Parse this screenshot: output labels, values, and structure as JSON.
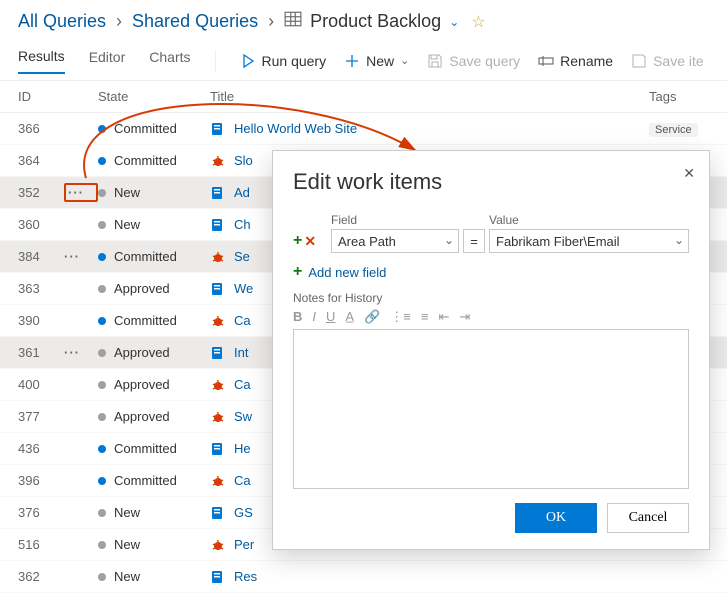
{
  "breadcrumb": {
    "root": "All Queries",
    "mid": "Shared Queries",
    "current": "Product Backlog"
  },
  "tabs": {
    "results": "Results",
    "editor": "Editor",
    "charts": "Charts"
  },
  "toolbar": {
    "run": "Run query",
    "new": "New",
    "save": "Save query",
    "rename": "Rename",
    "saveitems": "Save ite"
  },
  "columns": {
    "id": "ID",
    "state": "State",
    "title": "Title",
    "tags": "Tags"
  },
  "rows": [
    {
      "id": "366",
      "dots": false,
      "sel": false,
      "stateColor": "c-blue",
      "state": "Committed",
      "icon": "book",
      "title": "Hello World Web Site",
      "tag": "Service"
    },
    {
      "id": "364",
      "dots": false,
      "sel": false,
      "stateColor": "c-blue",
      "state": "Committed",
      "icon": "bug",
      "title": "Slo"
    },
    {
      "id": "352",
      "dots": true,
      "dotsBoxed": true,
      "sel": true,
      "stateColor": "c-gray",
      "state": "New",
      "icon": "book",
      "title": "Ad"
    },
    {
      "id": "360",
      "dots": false,
      "sel": false,
      "stateColor": "c-gray",
      "state": "New",
      "icon": "book",
      "title": "Ch"
    },
    {
      "id": "384",
      "dots": true,
      "sel": true,
      "stateColor": "c-blue",
      "state": "Committed",
      "icon": "bug",
      "title": "Se"
    },
    {
      "id": "363",
      "dots": false,
      "sel": false,
      "stateColor": "c-gray",
      "state": "Approved",
      "icon": "book",
      "title": "We"
    },
    {
      "id": "390",
      "dots": false,
      "sel": false,
      "stateColor": "c-blue",
      "state": "Committed",
      "icon": "bug",
      "title": "Ca"
    },
    {
      "id": "361",
      "dots": true,
      "sel": true,
      "stateColor": "c-gray",
      "state": "Approved",
      "icon": "book",
      "title": "Int"
    },
    {
      "id": "400",
      "dots": false,
      "sel": false,
      "stateColor": "c-gray",
      "state": "Approved",
      "icon": "bug",
      "title": "Ca"
    },
    {
      "id": "377",
      "dots": false,
      "sel": false,
      "stateColor": "c-gray",
      "state": "Approved",
      "icon": "bug",
      "title": "Sw"
    },
    {
      "id": "436",
      "dots": false,
      "sel": false,
      "stateColor": "c-blue",
      "state": "Committed",
      "icon": "book",
      "title": "He"
    },
    {
      "id": "396",
      "dots": false,
      "sel": false,
      "stateColor": "c-blue",
      "state": "Committed",
      "icon": "bug",
      "title": "Ca"
    },
    {
      "id": "376",
      "dots": false,
      "sel": false,
      "stateColor": "c-gray",
      "state": "New",
      "icon": "book",
      "title": "GS"
    },
    {
      "id": "516",
      "dots": false,
      "sel": false,
      "stateColor": "c-gray",
      "state": "New",
      "icon": "bug",
      "title": "Per"
    },
    {
      "id": "362",
      "dots": false,
      "sel": false,
      "stateColor": "c-gray",
      "state": "New",
      "icon": "book",
      "title": "Res"
    }
  ],
  "modal": {
    "title": "Edit work items",
    "fieldLabel": "Field",
    "valueLabel": "Value",
    "fieldValue": "Area Path",
    "opValue": "=",
    "valueValue": "Fabrikam Fiber\\Email",
    "addField": "Add new field",
    "notesLabel": "Notes for History",
    "ok": "OK",
    "cancel": "Cancel"
  }
}
